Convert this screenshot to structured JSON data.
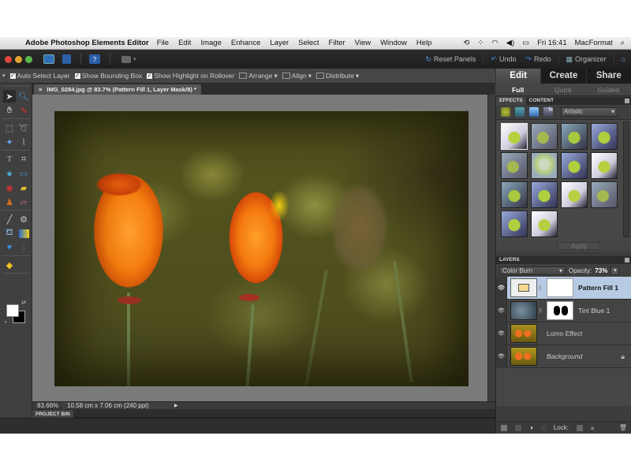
{
  "menubar": {
    "apple_icon": "apple-logo",
    "app_name": "Adobe Photoshop Elements Editor",
    "menus": [
      "File",
      "Edit",
      "Image",
      "Enhance",
      "Layer",
      "Select",
      "Filter",
      "View",
      "Window",
      "Help"
    ],
    "status_icons": [
      "time-machine-icon",
      "bluetooth-icon",
      "wifi-icon",
      "volume-icon",
      "battery-icon"
    ],
    "clock": "Fri 16:41",
    "user": "MacFormat",
    "spotlight_icon": "search-icon"
  },
  "appbar": {
    "reset_panels": "Reset Panels",
    "undo": "Undo",
    "redo": "Redo",
    "organizer": "Organizer"
  },
  "options": {
    "auto_select_layer": "Auto Select Layer",
    "show_bounding_box": "Show Bounding Box",
    "show_highlight": "Show Highlight on Rollover",
    "arrange": "Arrange",
    "align": "Align",
    "distribute": "Distribute"
  },
  "mode_tabs": {
    "edit": "Edit",
    "create": "Create",
    "share": "Share",
    "full": "Full",
    "quick": "Quick",
    "guided": "Guided"
  },
  "document": {
    "tab_title": "IMG_0284.jpg @ 83.7% (Pattern Fill 1, Layer Mask/8) *",
    "close": "×",
    "zoom": "83.66%",
    "dimensions": "10.58 cm x 7.06 cm (240 ppi)",
    "project_bin": "PROJECT BIN"
  },
  "effects": {
    "tab_effects": "EFFECTS",
    "tab_content": "CONTENT",
    "category": "Artistic",
    "thumb_count": 14,
    "apply": "Apply"
  },
  "layers": {
    "title": "LAYERS",
    "blend_mode": "Color Burn",
    "opacity_label": "Opacity:",
    "opacity": "73%",
    "items": [
      {
        "name": "Pattern Fill 1",
        "selected": true
      },
      {
        "name": "Tint Blue 1",
        "selected": false
      },
      {
        "name": "Lomo Effect",
        "selected": false
      },
      {
        "name": "Background",
        "selected": false,
        "locked": true
      }
    ],
    "lock_label": "Lock:"
  }
}
